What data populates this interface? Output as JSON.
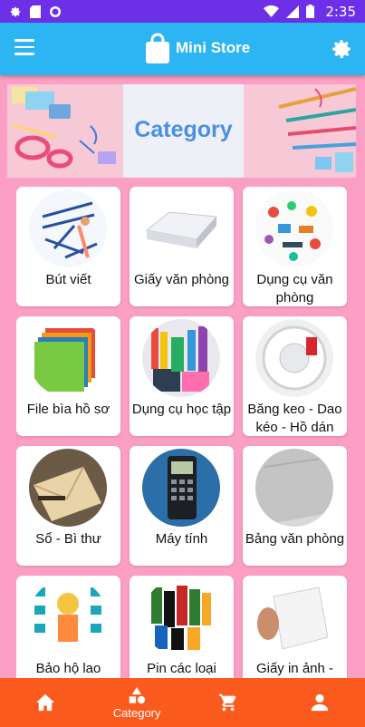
{
  "status_bar": {
    "time": "2:35"
  },
  "app_bar": {
    "title": "Mini Store"
  },
  "banner": {
    "title": "Category"
  },
  "categories": [
    {
      "label": "Bút viết"
    },
    {
      "label": "Giấy văn phòng"
    },
    {
      "label": "Dụng cụ văn phòng"
    },
    {
      "label": "File bìa hồ sơ"
    },
    {
      "label": "Dụng cụ học tập"
    },
    {
      "label": "Băng keo - Dao kéo - Hồ dán"
    },
    {
      "label": "Sổ - Bì thư"
    },
    {
      "label": "Máy tính"
    },
    {
      "label": "Bảng văn phòng"
    },
    {
      "label": "Bảo hộ lao"
    },
    {
      "label": "Pin các loại"
    },
    {
      "label": "Giấy in ảnh -"
    }
  ],
  "bottom_nav": {
    "category_label": "Category"
  },
  "colors": {
    "status_bar": "#6d30e8",
    "app_bar": "#2db4f3",
    "background": "#fc9fc4",
    "bottom_nav": "#fb5a1e"
  }
}
